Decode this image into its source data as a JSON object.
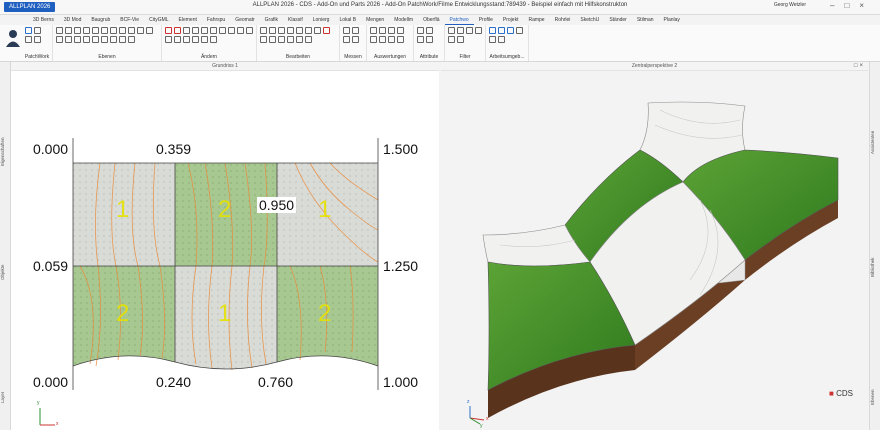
{
  "app": {
    "button_label": "ALLPLAN 2026",
    "window_title": "ALLPLAN 2026 - CDS - Add-On und Parts 2026 - Add-On PatchWork/Filme Entwicklungsstand:789439 - Beispiel einfach mit Hilfskonstrukton",
    "user_name": "Georg Wetzler"
  },
  "tabs": [
    "3D Berns",
    "3D Mod",
    "Baugrub",
    "BCF-Vie",
    "CityGML",
    "Element",
    "Fahrspu",
    "Geomatr",
    "Grafik",
    "Klassif",
    "Lonierg",
    "Lokal B",
    "Mengen",
    "Modellm",
    "Oberflä",
    "Patchwo",
    "Profile",
    "Projekt",
    "Rampe",
    "Rohrlei",
    "SketchU",
    "Ständer",
    "Stilman",
    "Planlay"
  ],
  "active_tab": "Patchwo",
  "ribbon_groups": [
    "PatchWork",
    "Ebenen",
    "Ändern",
    "Bearbeiten",
    "Messen",
    "Auswertungen",
    "Attribute",
    "Filter",
    "Arbeitsumgeb..."
  ],
  "left_sidebar": [
    "Eigenschaften",
    "Objekte",
    "Layer"
  ],
  "right_sidebar": [
    "Assistenten",
    "Bibliothek",
    "Ebenen"
  ],
  "viewport_left": {
    "title": "Grundriss 1",
    "values": {
      "tl": "0.000",
      "tm": "0.359",
      "tr": "1.500",
      "ml": "0.059",
      "center": "0.950",
      "mr": "1.250",
      "bl": "0.000",
      "bm1": "0.240",
      "bm2": "0.760",
      "br": "1.000"
    },
    "zones": [
      "1",
      "2",
      "1",
      "2",
      "1",
      "2"
    ],
    "axis_x": "x",
    "axis_y": "y"
  },
  "viewport_right": {
    "title": "Zentralperspektive 2",
    "brand": "CDS",
    "axis_x": "x",
    "axis_y": "y",
    "axis_z": "z"
  },
  "colors": {
    "accent": "#1f5fbf",
    "grass": "#4a9a2a",
    "soil": "#6b3f24",
    "contour": "#e98a3a"
  }
}
